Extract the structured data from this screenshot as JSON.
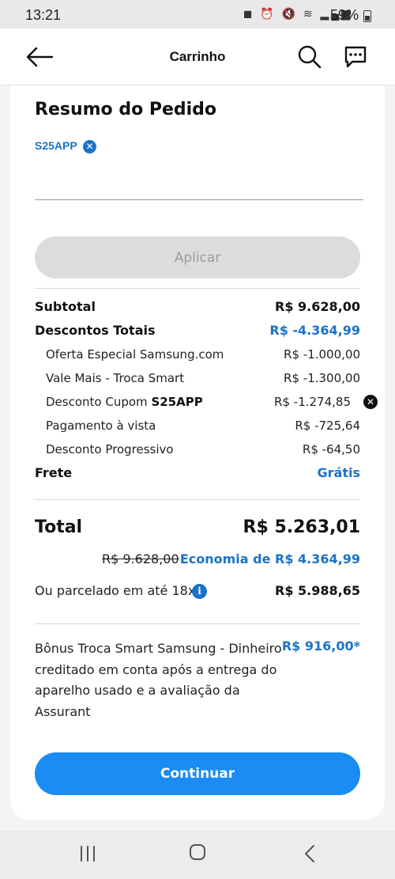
{
  "status_bar": {
    "time": "13:21",
    "battery": "59%"
  },
  "header": {
    "title": "Carrinho"
  },
  "summary": {
    "title": "Resumo do Pedido",
    "applied_coupon": "S25APP",
    "coupon_input_value": "",
    "apply_label": "Aplicar"
  },
  "rows": {
    "subtotal": {
      "label": "Subtotal",
      "value": "R$ 9.628,00"
    },
    "discounts_total": {
      "label": "Descontos Totais",
      "value": "R$ -4.364,99"
    },
    "discounts": [
      {
        "label": "Oferta Especial Samsung.com",
        "value": "R$ -1.000,00"
      },
      {
        "label": "Vale Mais - Troca Smart",
        "value": "R$ -1.300,00"
      },
      {
        "label_prefix": "Desconto Cupom",
        "label_code": "S25APP",
        "value": "R$ -1.274,85"
      },
      {
        "label": "Pagamento à vista",
        "value": "R$ -725,64"
      },
      {
        "label": "Desconto Progressivo",
        "value": "R$ -64,50"
      }
    ],
    "shipping": {
      "label": "Frete",
      "value": "Grátis"
    }
  },
  "total": {
    "label": "Total",
    "value": "R$ 5.263,01",
    "old_price": "R$ 9.628,00",
    "economy": "Economia de R$ 4.364,99",
    "installments_label": "Ou parcelado em até 18x",
    "installments_value": "R$ 5.988,65"
  },
  "bonus": {
    "text": "Bônus Troca Smart Samsung - Dinheiro creditado em conta após a entrega do aparelho usado e a avaliação da Assurant",
    "value": "R$ 916,00*"
  },
  "continue_label": "Continuar",
  "colors": {
    "accent": "#1a73c8",
    "button": "#1a8cf3",
    "disabled": "#dcdcdc"
  }
}
